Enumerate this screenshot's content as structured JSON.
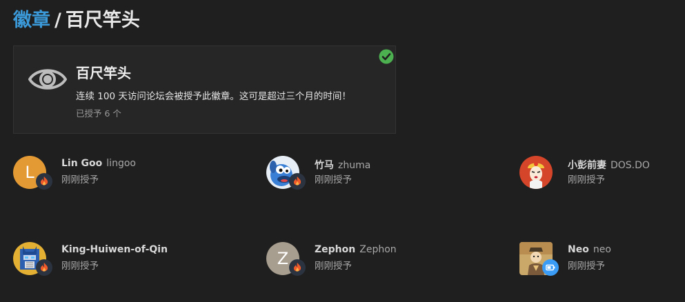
{
  "header": {
    "breadcrumb": "徽章",
    "separator": "/",
    "title": "百尺竿头"
  },
  "badge": {
    "icon": "eye-icon",
    "name": "百尺竿头",
    "description": "连续 100 天访问论坛会被授予此徽章。这可是超过三个月的时间！",
    "granted": "已授予 6 个",
    "status_icon": "check-circle-icon",
    "status_color": "#4caf50"
  },
  "users": [
    {
      "display": "Lin Goo",
      "handle": "lingoo",
      "time": "刚刚授予",
      "avatar_letter": "L",
      "avatar_color": "#e49a34",
      "mini_badge": "fire-icon"
    },
    {
      "display": "竹马",
      "handle": "zhuma",
      "time": "刚刚授予",
      "avatar_letter": "",
      "avatar_color": "#3a7fd6",
      "mini_badge": "fire-icon"
    },
    {
      "display": "小彭前妻",
      "handle": "DOS.DO",
      "time": "刚刚授予",
      "avatar_letter": "",
      "avatar_color": "#d4452a",
      "mini_badge": ""
    },
    {
      "display": "King-Huiwen-of-Qin",
      "handle": "",
      "time": "刚刚授予",
      "avatar_letter": "",
      "avatar_color": "#e3b033",
      "mini_badge": "fire-icon"
    },
    {
      "display": "Zephon",
      "handle": "Zephon",
      "time": "刚刚授予",
      "avatar_letter": "Z",
      "avatar_color": "#a89e8f",
      "mini_badge": "fire-icon"
    },
    {
      "display": "Neo",
      "handle": "neo",
      "time": "刚刚授予",
      "avatar_letter": "",
      "avatar_color": "#c9a86a",
      "mini_badge": "battery-icon"
    }
  ]
}
